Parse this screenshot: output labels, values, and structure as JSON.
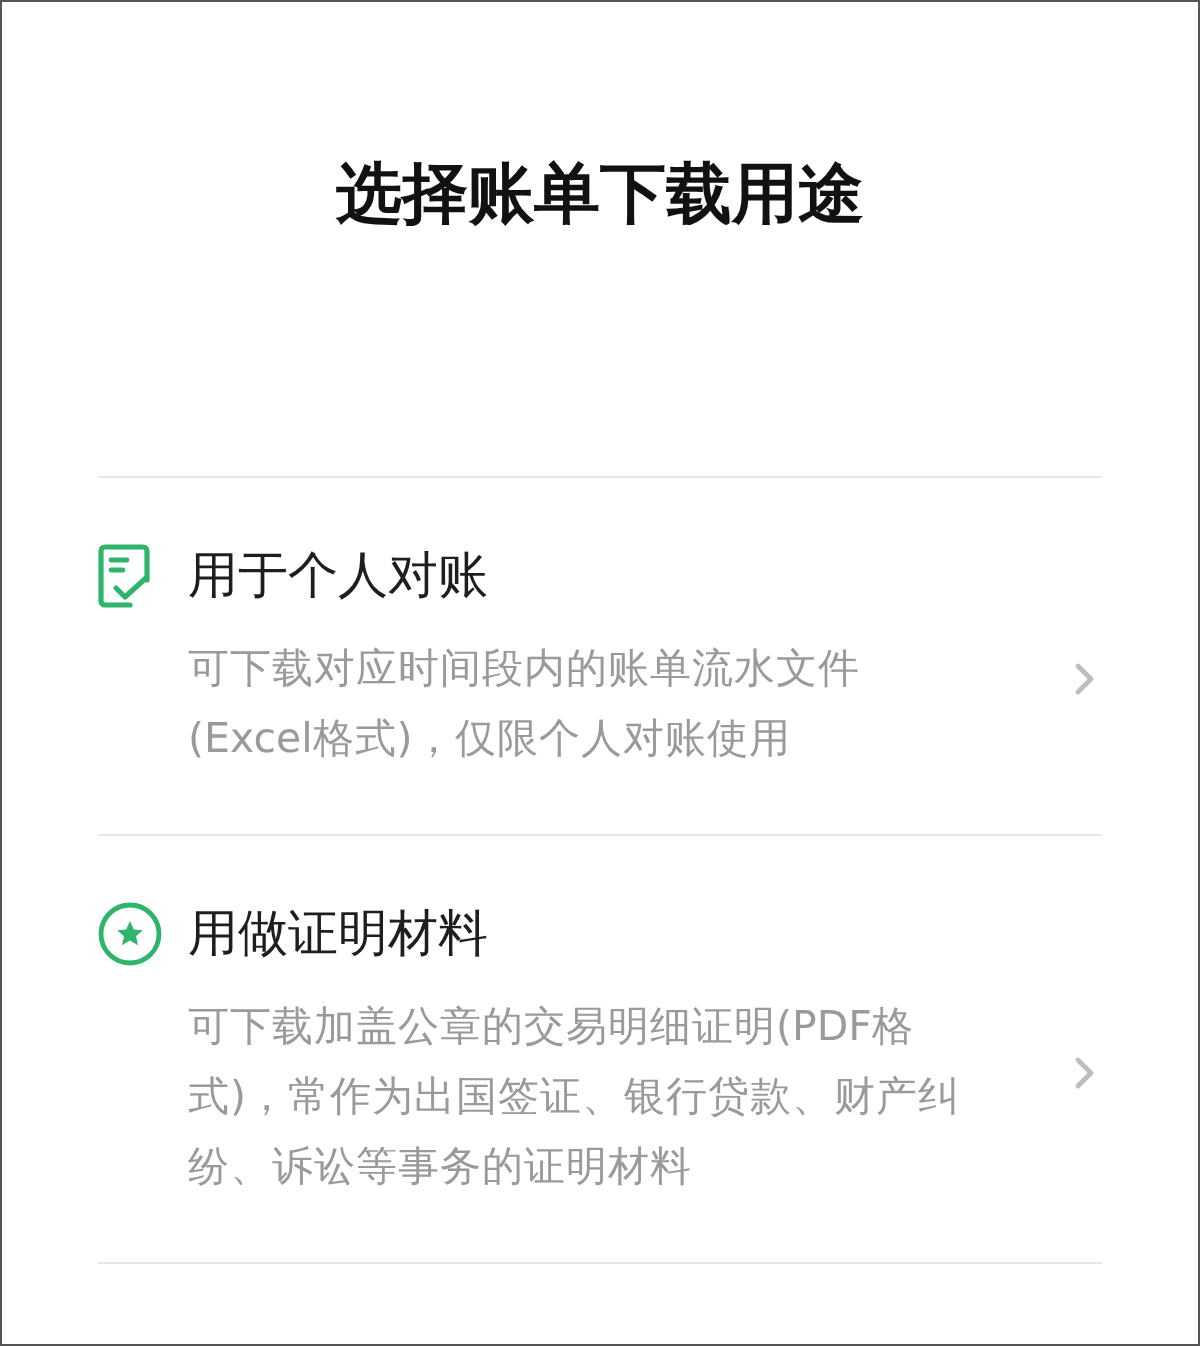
{
  "title": "选择账单下载用途",
  "options": [
    {
      "kind": "document",
      "title": "用于个人对账",
      "description_lines": [
        "可下载对应时间段内的账单流水文件",
        "(Excel格式)，仅限个人对账使用"
      ]
    },
    {
      "kind": "certificate",
      "title": "用做证明材料",
      "description_lines": [
        "可下载加盖公章的交易明细证明(PDF格",
        "式)，常作为出国签证、银行贷款、财产纠",
        "纷、诉讼等事务的证明材料"
      ]
    }
  ]
}
